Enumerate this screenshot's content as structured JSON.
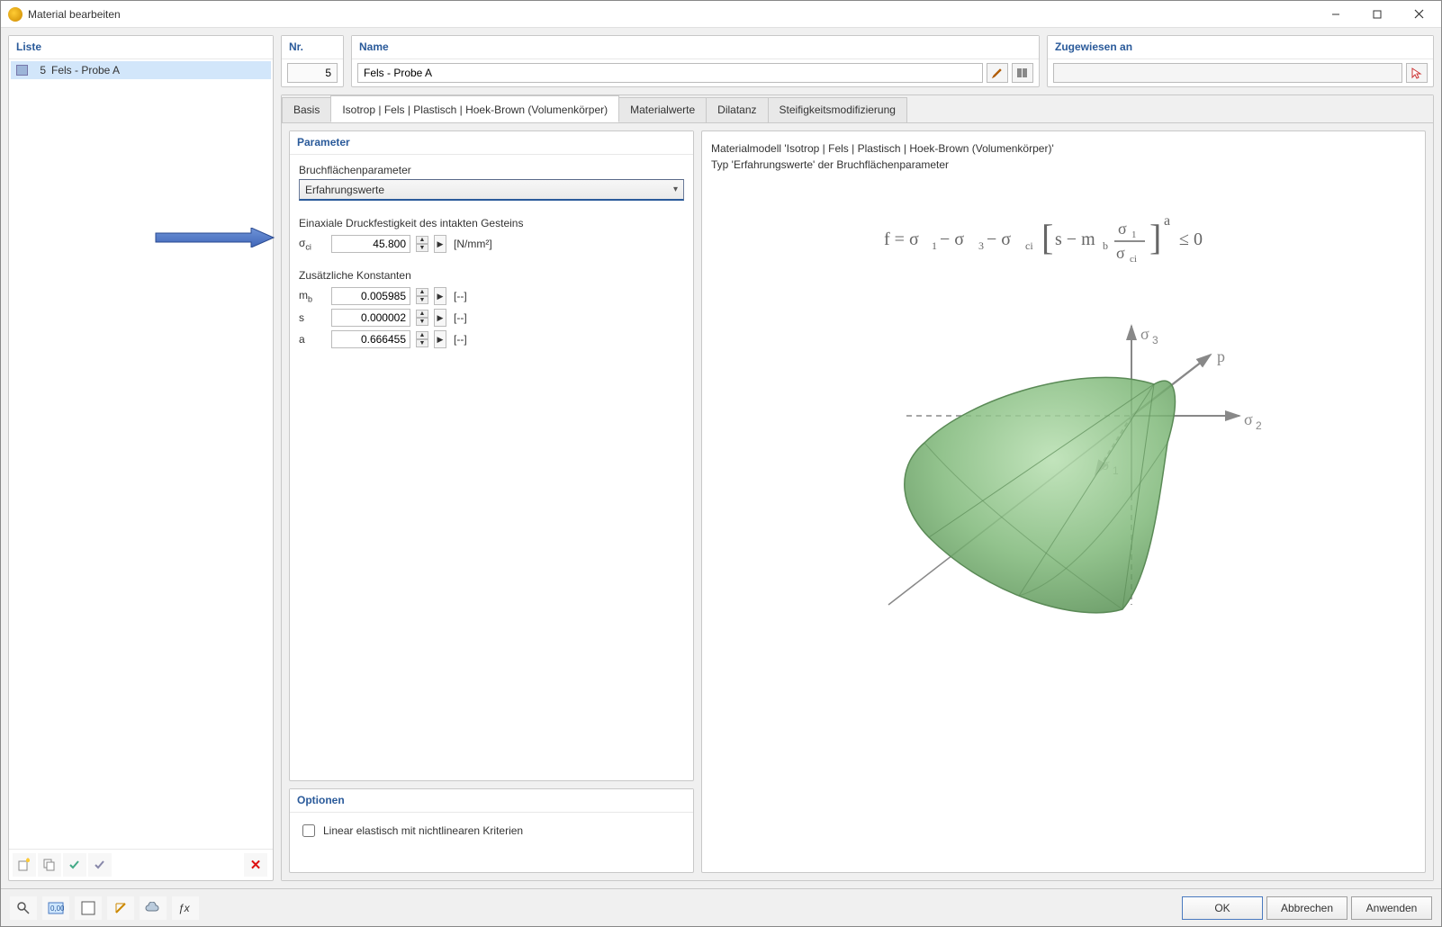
{
  "window": {
    "title": "Material bearbeiten"
  },
  "liste": {
    "header": "Liste",
    "items": [
      {
        "num": "5",
        "label": "Fels - Probe A"
      }
    ]
  },
  "nr": {
    "header": "Nr.",
    "value": "5"
  },
  "name": {
    "header": "Name",
    "value": "Fels - Probe A"
  },
  "zugewiesen": {
    "header": "Zugewiesen an",
    "value": ""
  },
  "tabs": {
    "basis": "Basis",
    "isotrop": "Isotrop | Fels | Plastisch | Hoek-Brown (Volumenkörper)",
    "materialwerte": "Materialwerte",
    "dilatanz": "Dilatanz",
    "steifigkeit": "Steifigkeitsmodifizierung"
  },
  "parameter": {
    "header": "Parameter",
    "bfp_label": "Bruchflächenparameter",
    "bfp_value": "Erfahrungswerte",
    "edf_label": "Einaxiale Druckfestigkeit des intakten Gesteins",
    "sigma_ci": {
      "sym": "σci",
      "value": "45.800",
      "unit": "[N/mm²]"
    },
    "zk_label": "Zusätzliche Konstanten",
    "mb": {
      "sym": "mb",
      "value": "0.005985",
      "unit": "[--]"
    },
    "s": {
      "sym": "s",
      "value": "0.000002",
      "unit": "[--]"
    },
    "a": {
      "sym": "a",
      "value": "0.666455",
      "unit": "[--]"
    }
  },
  "optionen": {
    "header": "Optionen",
    "linear_label": "Linear elastisch mit nichtlinearen Kriterien"
  },
  "rightdesc": {
    "line1": "Materialmodell 'Isotrop | Fels | Plastisch | Hoek-Brown (Volumenkörper)'",
    "line2": "Typ 'Erfahrungswerte' der Bruchflächenparameter"
  },
  "footer": {
    "ok": "OK",
    "abbrechen": "Abbrechen",
    "anwenden": "Anwenden"
  }
}
